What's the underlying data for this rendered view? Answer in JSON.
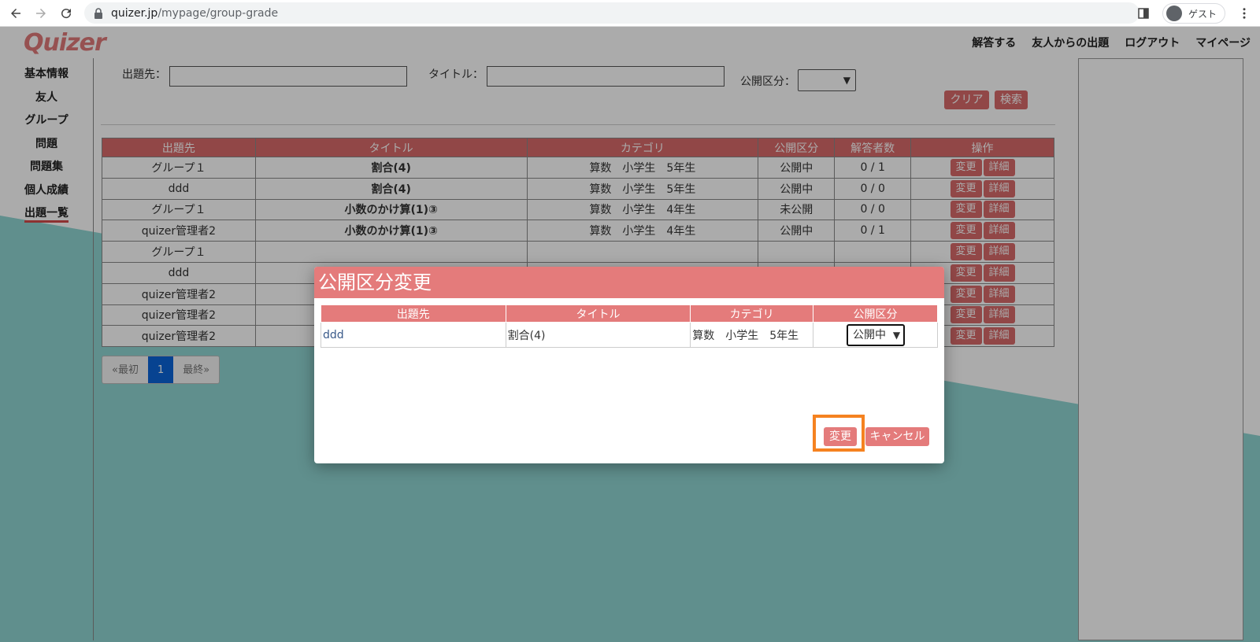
{
  "browser": {
    "url_host": "quizer.jp",
    "url_path": "/mypage/group-grade",
    "profile_label": "ゲスト"
  },
  "app": {
    "logo": "Quizer",
    "topnav": [
      "解答する",
      "友人からの出題",
      "ログアウト",
      "マイページ"
    ],
    "sidebar": [
      "基本情報",
      "友人",
      "グループ",
      "問題",
      "問題集",
      "個人成績",
      "出題一覧"
    ],
    "active_sidebar": "出題一覧"
  },
  "search": {
    "dest_label": "出題先：",
    "dest_value": "",
    "title_label": "タイトル：",
    "title_value": "",
    "visibility_label": "公開区分：",
    "visibility_value": "",
    "clear_label": "クリア",
    "search_label": "検索"
  },
  "table": {
    "headers": [
      "出題先",
      "タイトル",
      "カテゴリ",
      "公開区分",
      "解答者数",
      "操作"
    ],
    "rows": [
      {
        "dest": "グループ１",
        "title": "割合(4)",
        "category": "算数　小学生　5年生",
        "visibility": "公開中",
        "answers": "0 / 1"
      },
      {
        "dest": "ddd",
        "title": "割合(4)",
        "category": "算数　小学生　5年生",
        "visibility": "公開中",
        "answers": "0 / 0"
      },
      {
        "dest": "グループ１",
        "title": "小数のかけ算(1)③",
        "category": "算数　小学生　4年生",
        "visibility": "未公開",
        "answers": "0 / 0"
      },
      {
        "dest": "quizer管理者2",
        "title": "小数のかけ算(1)③",
        "category": "算数　小学生　4年生",
        "visibility": "公開中",
        "answers": "0 / 1"
      },
      {
        "dest": "グループ１",
        "title": "",
        "category": "",
        "visibility": "",
        "answers": ""
      },
      {
        "dest": "ddd",
        "title": "",
        "category": "",
        "visibility": "",
        "answers": ""
      },
      {
        "dest": "quizer管理者2",
        "title": "",
        "category": "",
        "visibility": "",
        "answers": ""
      },
      {
        "dest": "quizer管理者2",
        "title": "",
        "category": "",
        "visibility": "",
        "answers": ""
      },
      {
        "dest": "quizer管理者2",
        "title": "",
        "category": "",
        "visibility": "",
        "answers": ""
      }
    ],
    "edit_label": "変更",
    "detail_label": "詳細"
  },
  "pager": {
    "first": "«最初",
    "current": "1",
    "last": "最終»"
  },
  "modal": {
    "title": "公開区分変更",
    "headers": [
      "出題先",
      "タイトル",
      "カテゴリ",
      "公開区分"
    ],
    "row": {
      "dest": "ddd",
      "title": "割合(4)",
      "category": "算数　小学生　5年生",
      "visibility": "公開中"
    },
    "change_label": "変更",
    "cancel_label": "キャンセル"
  },
  "colors": {
    "accent": "#d96b6b",
    "teal": "#8fd6d2",
    "highlight": "#f58220",
    "pager_active": "#0b65d8"
  }
}
